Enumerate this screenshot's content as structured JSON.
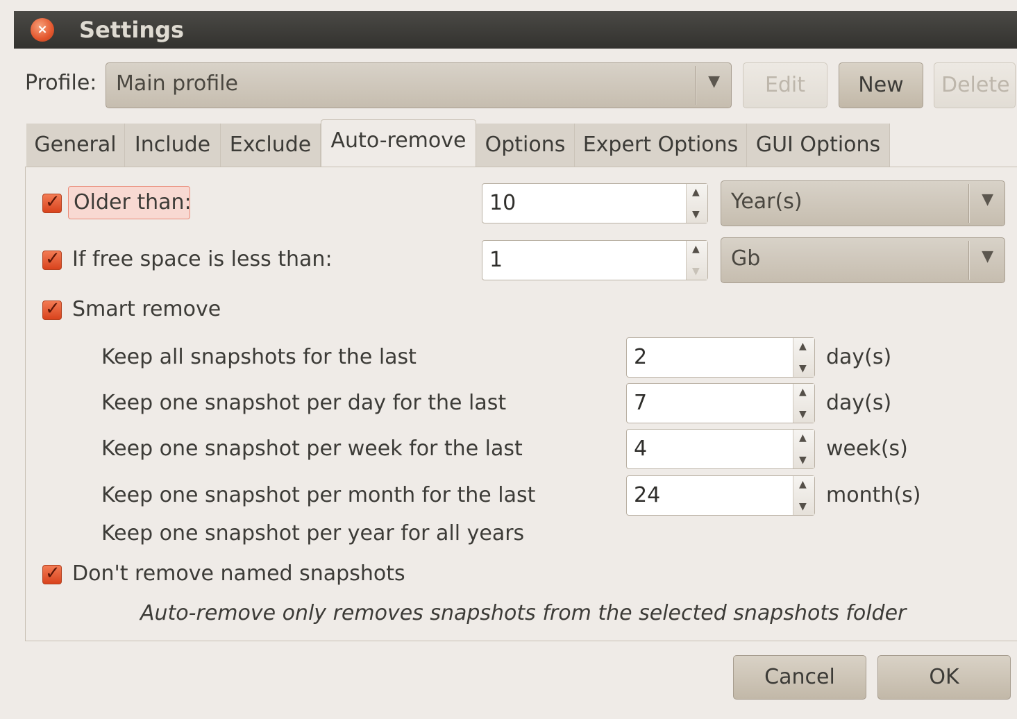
{
  "window": {
    "title": "Settings"
  },
  "profile": {
    "label": "Profile:",
    "selected": "Main profile",
    "edit_label": "Edit",
    "new_label": "New",
    "delete_label": "Delete"
  },
  "tabs": [
    {
      "label": "General"
    },
    {
      "label": "Include"
    },
    {
      "label": "Exclude"
    },
    {
      "label": "Auto-remove"
    },
    {
      "label": "Options"
    },
    {
      "label": "Expert Options"
    },
    {
      "label": "GUI Options"
    }
  ],
  "active_tab": "Auto-remove",
  "auto_remove": {
    "older_than": {
      "label": "Older than:",
      "checked": true,
      "value": "10",
      "unit": "Year(s)"
    },
    "free_space": {
      "label": "If free space is less than:",
      "checked": true,
      "value": "1",
      "unit": "Gb"
    },
    "smart_remove": {
      "label": "Smart remove",
      "checked": true,
      "rules": [
        {
          "label": "Keep all snapshots for the last",
          "value": "2",
          "unit": "day(s)"
        },
        {
          "label": "Keep one snapshot per day for the last",
          "value": "7",
          "unit": "day(s)"
        },
        {
          "label": "Keep one snapshot per week for the last",
          "value": "4",
          "unit": "week(s)"
        },
        {
          "label": "Keep one snapshot per month for the last",
          "value": "24",
          "unit": "month(s)"
        }
      ],
      "yearly_label": "Keep one snapshot per year for all years"
    },
    "dont_remove_named": {
      "label": "Don't remove named snapshots",
      "checked": true
    },
    "note": "Auto-remove only removes snapshots from the selected snapshots folder"
  },
  "footer": {
    "cancel_label": "Cancel",
    "ok_label": "OK"
  },
  "colors": {
    "accent": "#e4572e",
    "titlebar": "#3c3b37"
  },
  "glyphs": {
    "close": "×",
    "check": "✓",
    "arrow": "▼",
    "up": "▲",
    "down": "▼"
  }
}
